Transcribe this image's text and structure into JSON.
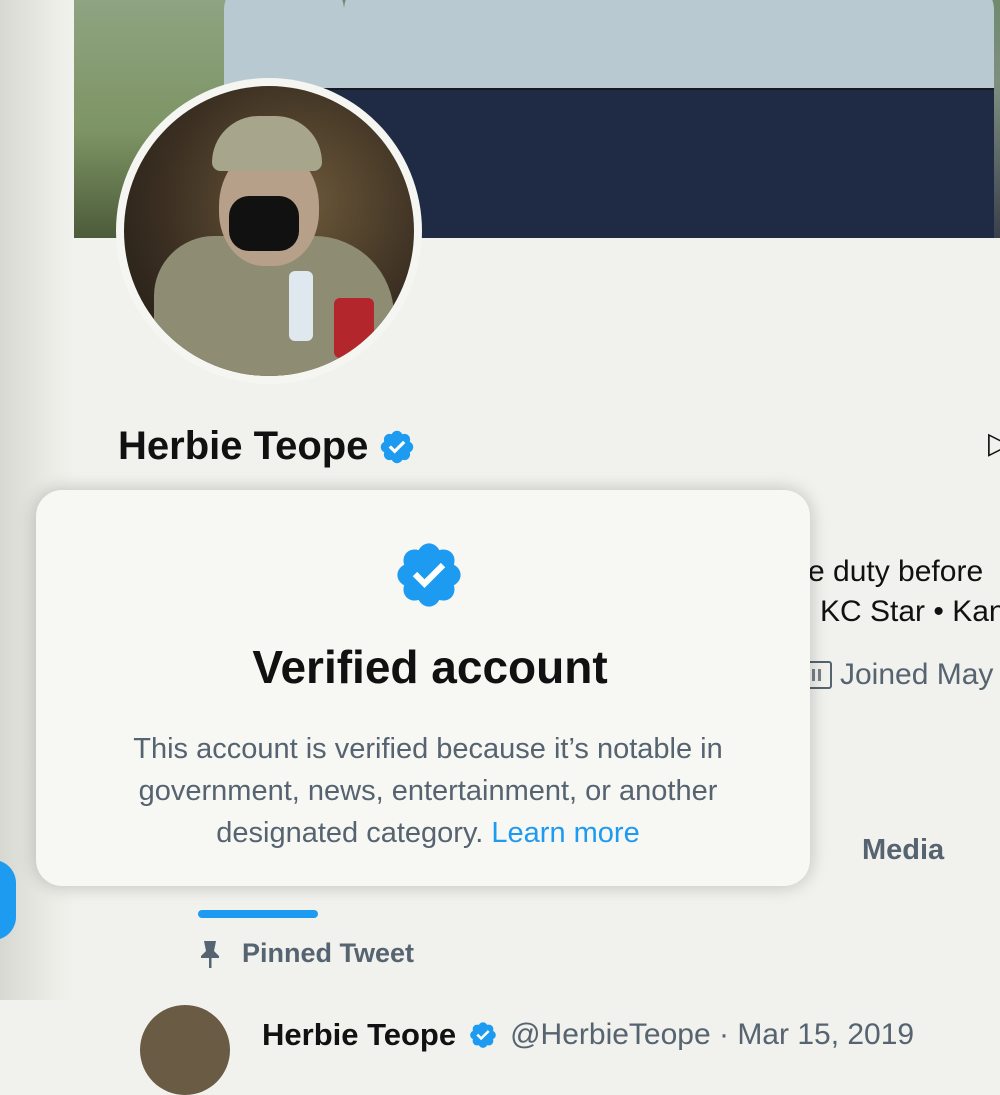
{
  "profile": {
    "name": "Herbie Teope"
  },
  "bio": {
    "line1": "e duty before",
    "line2": "KC Star • Kan",
    "joined": "Joined May"
  },
  "tabs": {
    "media": "Media"
  },
  "pinned": {
    "label": "Pinned Tweet",
    "tweet_name": "Herbie Teope",
    "tweet_meta": "@HerbieTeope · Mar 15, 2019"
  },
  "popup": {
    "title": "Verified account",
    "body": "This account is verified because it’s notable in government, news, entertainment, or another designated category.",
    "link": "Learn more"
  },
  "icons": {
    "verified": "verified-badge-icon",
    "calendar": "calendar-icon",
    "pin": "pin-icon",
    "cursor": "cursor-icon"
  },
  "colors": {
    "accent": "#1d9bf0",
    "secondary_text": "#566370"
  }
}
